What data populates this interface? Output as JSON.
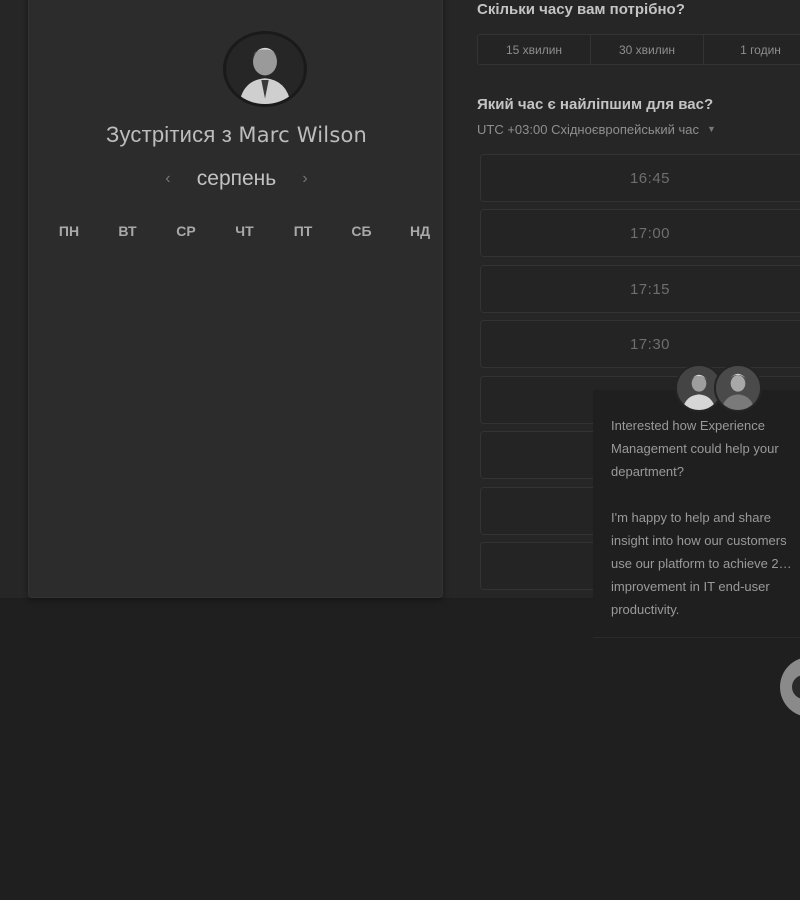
{
  "calendar": {
    "title_prefix": "Зустрітися з",
    "host_name": "Marc Wilson",
    "month": "серпень",
    "prev_icon": "‹",
    "next_icon": "›",
    "weekdays": [
      "ПН",
      "ВТ",
      "СР",
      "ЧТ",
      "ПТ",
      "СБ",
      "НД"
    ]
  },
  "booking": {
    "duration_question": "Скільки часу вам потрібно?",
    "durations": [
      "15 хвилин",
      "30 хвилин",
      "1 годин"
    ],
    "time_question": "Який час є найліпшим для вас?",
    "timezone": "UTC +03:00 Східноєвропейський час",
    "timezone_caret": "▼",
    "slots": [
      "16:45",
      "17:00",
      "17:15",
      "17:30",
      "",
      "",
      "",
      ""
    ]
  },
  "chat": {
    "message_1": "Interested how Experience Management could help your department?",
    "message_2": "I'm happy to help and share insight into how our customers use our platform to achieve 2… improvement in IT end-user productivity."
  },
  "icons": {
    "host_avatar": "avatar",
    "agent_avatar_1": "avatar",
    "agent_avatar_2": "avatar",
    "chat_launcher": "chat-bubble-icon"
  }
}
